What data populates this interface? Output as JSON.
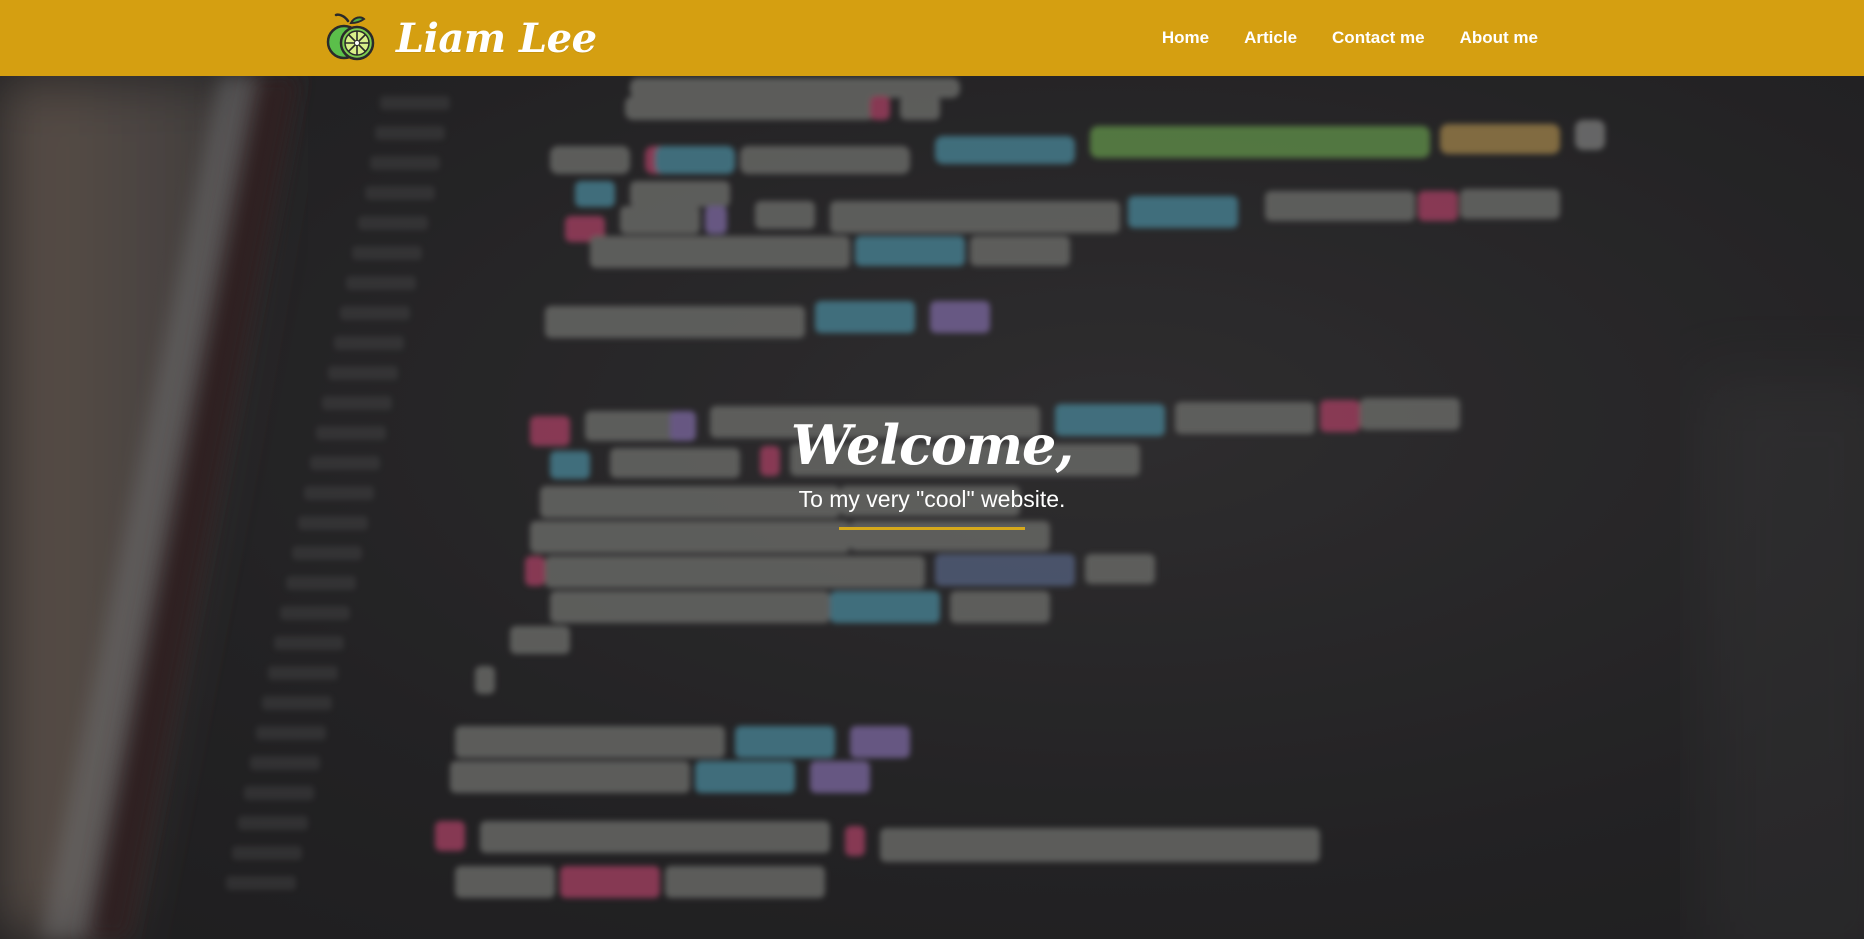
{
  "brand": {
    "name": "Liam Lee",
    "logo_icon": "lime-icon"
  },
  "nav": {
    "items": [
      {
        "label": "Home"
      },
      {
        "label": "Article"
      },
      {
        "label": "Contact me"
      },
      {
        "label": "About me"
      }
    ]
  },
  "hero": {
    "title": "Welcome,",
    "subtitle": "To my very \"cool\" website."
  },
  "colors": {
    "navbar": "#d59f11",
    "accent_rule": "#d6a91b",
    "text": "#ffffff",
    "hero_bg": "#2b2a2b"
  }
}
